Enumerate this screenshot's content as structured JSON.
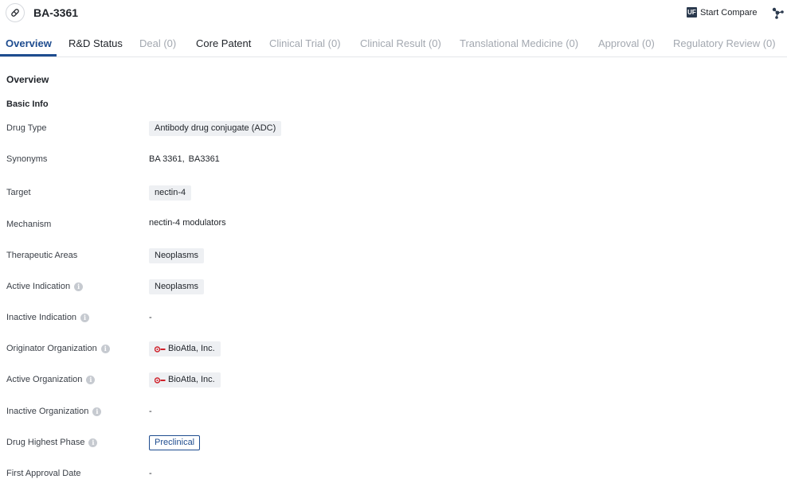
{
  "header": {
    "title": "BA-3361",
    "compare_icon_text": "UF",
    "compare_label": "Start Compare"
  },
  "tabs": [
    {
      "label": "Overview"
    },
    {
      "label": "R&D Status"
    },
    {
      "label": "Deal (0)"
    },
    {
      "label": "Core Patent"
    },
    {
      "label": "Clinical Trial (0)"
    },
    {
      "label": "Clinical Result (0)"
    },
    {
      "label": "Translational Medicine (0)"
    },
    {
      "label": "Approval (0)"
    },
    {
      "label": "Regulatory Review (0)"
    }
  ],
  "overview": {
    "section_title": "Overview",
    "basic_info_title": "Basic Info",
    "drug_type": {
      "label": "Drug Type",
      "value": "Antibody drug conjugate (ADC)"
    },
    "synonyms": {
      "label": "Synonyms",
      "values": [
        "BA 3361,",
        "BA3361"
      ]
    },
    "target": {
      "label": "Target",
      "value": "nectin-4"
    },
    "mechanism": {
      "label": "Mechanism",
      "value": "nectin-4 modulators"
    },
    "therapeutic_areas": {
      "label": "Therapeutic Areas",
      "value": "Neoplasms"
    },
    "active_indication": {
      "label": "Active Indication",
      "value": "Neoplasms"
    },
    "inactive_indication": {
      "label": "Inactive Indication",
      "value": "-"
    },
    "originator_org": {
      "label": "Originator Organization",
      "value": "BioAtla, Inc."
    },
    "active_org": {
      "label": "Active Organization",
      "value": "BioAtla, Inc."
    },
    "inactive_org": {
      "label": "Inactive Organization",
      "value": "-"
    },
    "highest_phase": {
      "label": "Drug Highest Phase",
      "value": "Preclinical"
    },
    "first_approval": {
      "label": "First Approval Date",
      "value": "-"
    }
  },
  "colors": {
    "accent": "#1e4c8f",
    "disabled_tab": "#a3a8b0",
    "chip_bg": "#eef0f3"
  }
}
